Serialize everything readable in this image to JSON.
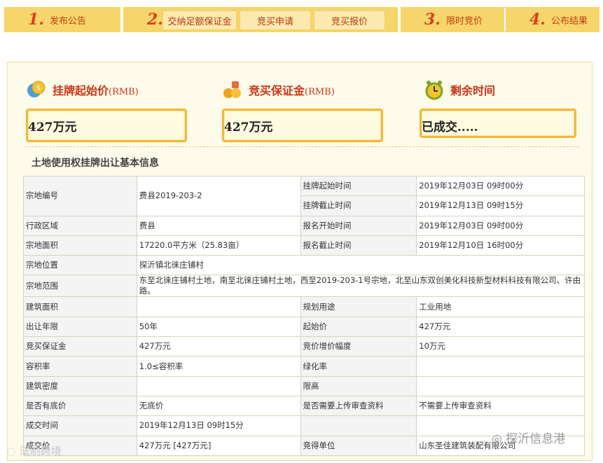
{
  "steps": {
    "s1": {
      "num": "1.",
      "label": "发布公告"
    },
    "s2": {
      "num": "2.",
      "sub": [
        "交纳足额保证金",
        "竞买申请",
        "竞买报价"
      ]
    },
    "s3": {
      "num": "3.",
      "label": "限时竞价"
    },
    "s4": {
      "num": "4.",
      "label": "公布结果"
    }
  },
  "cards": {
    "start_price": {
      "title": "挂牌起始价",
      "unit": "(RMB)",
      "value": "427万元",
      "icon": "coins-icon"
    },
    "deposit": {
      "title": "竞买保证金",
      "unit": "(RMB)",
      "value": "427万元",
      "icon": "money-bag-icon"
    },
    "remaining": {
      "title": "剩余时间",
      "value": "已成交.....",
      "icon": "alarm-clock-icon"
    }
  },
  "section_title": "土地使用权挂牌出让基本信息",
  "table": {
    "r1": {
      "k": "宗地编号",
      "v": "费县2019-203-2",
      "k2a": "挂牌起始时间",
      "v2a": "2019年12月03日 09时00分",
      "k2b": "挂牌截止时间",
      "v2b": "2019年12月13日 09时15分"
    },
    "r2": {
      "k": "行政区域",
      "v": "费县",
      "k2": "报名开始时间",
      "v2": "2019年12月03日 09时00分"
    },
    "r3": {
      "k": "宗地面积",
      "v": "17220.0平方米（25.83亩）",
      "k2": "报名截止时间",
      "v2": "2019年12月10日 16时00分"
    },
    "r4": {
      "k": "宗地位置",
      "v": "探沂镇北徕庄铺村"
    },
    "r5": {
      "k": "宗地范围",
      "v": "东至北徕庄铺村土地，南至北徕庄铺村土地，西至2019-203-1号宗地，北至山东双创美化科技新型材料科技有限公司、许由路。"
    },
    "r6": {
      "k": "建筑面积",
      "v": "",
      "k2": "规划用途",
      "v2": "工业用地"
    },
    "r7": {
      "k": "出让年限",
      "v": "50年",
      "k2": "起始价",
      "v2": "427万元"
    },
    "r8": {
      "k": "竞买保证金",
      "v": "427万元",
      "k2": "竞价增价幅度",
      "v2": "10万元"
    },
    "r9": {
      "k": "容积率",
      "v": "1.0≤容积率",
      "k2": "绿化率",
      "v2": ""
    },
    "r10": {
      "k": "建筑密度",
      "v": "",
      "k2": "限高",
      "v2": ""
    },
    "r11": {
      "k": "是否有底价",
      "v": "无底价",
      "k2": "是否需要上传审查资料",
      "v2": "不需要上传审查资料"
    },
    "r12": {
      "k": "成交时间",
      "v": "2019年12月13日 09时15分",
      "k2": "",
      "v2": ""
    },
    "r13": {
      "k": "成交价",
      "v": "427万元 [427万元]",
      "k2": "竞得单位",
      "v2": "山东圣佳建筑装配有限公司"
    }
  },
  "watermarks": {
    "right": "探沂信息港",
    "left": "法制跨境"
  }
}
